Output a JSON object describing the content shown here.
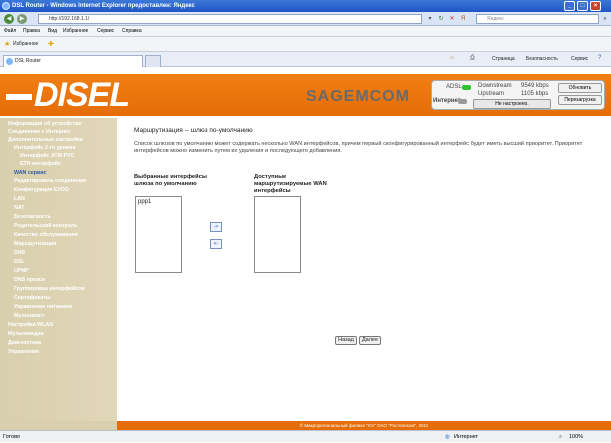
{
  "window": {
    "title": "DSL Router - Windows Internet Explorer предоставлен: Яндекс"
  },
  "address": {
    "url": "http://192.168.1.1/",
    "search_placeholder": "Яндекс"
  },
  "menu": [
    "Файл",
    "Правка",
    "Вид",
    "Избранное",
    "Сервис",
    "Справка"
  ],
  "favorites": {
    "label": "Избранное"
  },
  "tab": {
    "title": "DSL Router"
  },
  "ie_toolbar": {
    "page": "Страница",
    "security": "Безопасность",
    "tools": "Сервис"
  },
  "header": {
    "logo": "DISEL",
    "brand": "Sagemcom",
    "adsl": "ADSL",
    "internet": "Интернет",
    "downstream_label": "Downstream",
    "downstream_value": "9549 kbps",
    "upstream_label": "Upstream",
    "upstream_value": "1105 kbps",
    "not_configured": "Не настроено.",
    "refresh": "Обновить",
    "reboot": "Перезагрузка",
    "colors": {
      "orange": "#e56d08",
      "led_green": "#2fc42f",
      "led_gray": "#9a9a9a"
    }
  },
  "sidebar": {
    "items": [
      "Информация об устройстве",
      "Соединение с Интернет",
      "Дополнительные настройки",
      "Интерфейс 2-го уровня",
      "Интерфейс ATM PVC",
      "ETH интерфейс",
      "WAN сервис",
      "Редактировать соединение",
      "Конфигурация EVDO",
      "LAN",
      "NAT",
      "Безопасность",
      "Родительский контроль",
      "Качество обслуживания",
      "Маршрутизация",
      "DNS",
      "DSL",
      "UPNP",
      "DNS прокси",
      "Группировка интерфейсов",
      "Сертификаты",
      "Управление питанием",
      "Мультикаст",
      "Настройка WLAN",
      "Мультимедиа",
      "Диагностика",
      "Управление"
    ]
  },
  "main": {
    "title": "Маршрутизация -- шлюз по-умолчанию",
    "description": "Список шлюзов по умолчанию может содержать несколько WAN интерфейсов, причем первый сконфигурированный интерфейс будет иметь высший приоритет. Приоритет интерфейсов можно изменить путем их удаления и последующего добавления.",
    "selected_label": "Выбранные интерфейсы шлюза по умолчанию",
    "available_label": "Доступные маршрутизируемые WAN интерфейсы",
    "selected_items": [
      "ppp1"
    ],
    "move_right": "->",
    "move_left": "<-",
    "back": "Назад",
    "next": "Далее"
  },
  "footer": {
    "text": "© Макрорегиональный филиал \"Юг\" ОАО \"Ростелеком\", 2011"
  },
  "statusbar": {
    "left": "Готово",
    "zone": "Интернет",
    "zoom": "100%"
  }
}
